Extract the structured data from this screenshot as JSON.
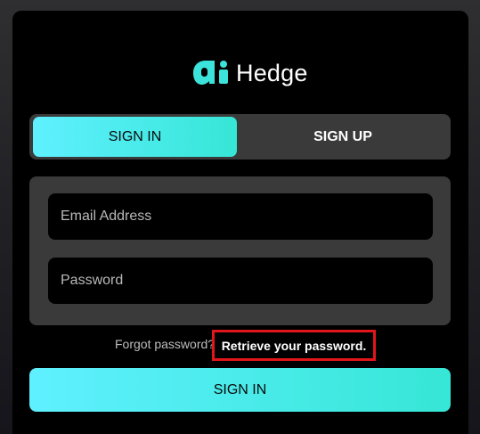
{
  "brand": {
    "name": "Hedge",
    "logo_icon": "ai-logo-icon",
    "accent_start": "#5ff0ff",
    "accent_end": "#36e6d6"
  },
  "tabs": [
    {
      "label": "SIGN IN",
      "active": true
    },
    {
      "label": "SIGN UP",
      "active": false
    }
  ],
  "form": {
    "email_placeholder": "Email Address",
    "password_placeholder": "Password"
  },
  "forgot": {
    "text": "Forgot password?",
    "link_label": "Retrieve your password.",
    "highlight_color": "#e0161b"
  },
  "submit_label": "SIGN IN"
}
